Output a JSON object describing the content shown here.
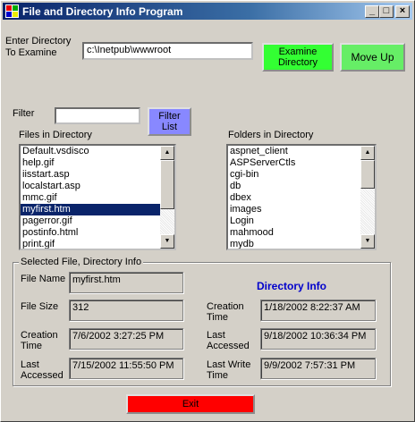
{
  "window": {
    "title": "File and Directory Info Program"
  },
  "colors": {
    "examine_btn": "#33ff33",
    "moveup_btn": "#66ee66",
    "filter_btn": "#8888ff",
    "exit_btn": "#ff0000",
    "dir_info": "#0000cc"
  },
  "controls": {
    "dir_label": "Enter Directory\nTo Examine",
    "dir_value": "c:\\Inetpub\\wwwroot",
    "examine_label": "Examine\nDirectory",
    "moveup_label": "Move Up",
    "filter_label": "Filter",
    "filter_value": "",
    "filter_btn_label": "Filter\nList",
    "files_label": "Files in Directory",
    "folders_label": "Folders in Directory"
  },
  "files": [
    "Default.vsdisco",
    "help.gif",
    "iisstart.asp",
    "localstart.asp",
    "mmc.gif",
    "myfirst.htm",
    "pagerror.gif",
    "postinfo.html",
    "print.gif"
  ],
  "files_selected": 5,
  "folders": [
    "aspnet_client",
    "ASPServerCtls",
    "cgi-bin",
    "db",
    "dbex",
    "images",
    "Login",
    "mahmood",
    "mydb"
  ],
  "info": {
    "group_title": "Selected File, Directory Info",
    "filename_label": "File Name",
    "filename_value": "myfirst.htm",
    "filesize_label": "File Size",
    "filesize_value": "312",
    "fcreation_label": "Creation\nTime",
    "fcreation_value": "7/6/2002 3:27:25 PM",
    "faccess_label": "Last\nAccessed",
    "faccess_value": "7/15/2002 11:55:50 PM",
    "dir_title": "Directory Info",
    "dcreation_label": "Creation\nTime",
    "dcreation_value": "1/18/2002 8:22:37 AM",
    "daccess_label": "Last\nAccessed",
    "daccess_value": "9/18/2002 10:36:34 PM",
    "dwrite_label": "Last Write\nTime",
    "dwrite_value": "9/9/2002 7:57:31 PM"
  },
  "exit_label": "Exit"
}
